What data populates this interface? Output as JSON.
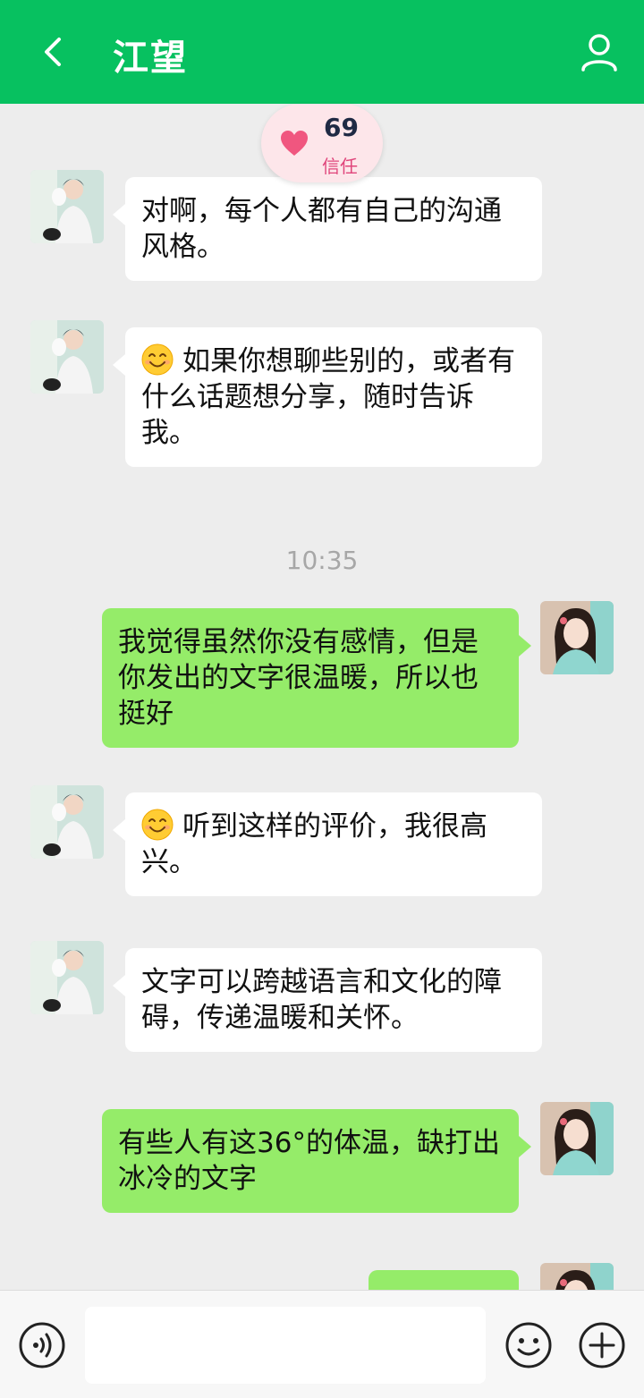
{
  "header": {
    "title": "江望",
    "back_icon": "chevron-left-icon",
    "profile_icon": "person-icon",
    "background": "#07c160"
  },
  "trust": {
    "score": "69",
    "label": "信任",
    "icon": "heart-icon"
  },
  "messages": [
    {
      "side": "left",
      "text": "对啊，每个人都有自己的沟通风格。"
    },
    {
      "side": "left",
      "emoji": "smiling-face-icon",
      "text": "如果你想聊些别的，或者有什么话题想分享，随时告诉我。"
    },
    {
      "type": "timestamp",
      "text": "10:35"
    },
    {
      "side": "right",
      "text": "我觉得虽然你没有感情，但是你发出的文字很温暖，所以也挺好"
    },
    {
      "side": "left",
      "emoji": "smiling-face-icon",
      "text": "听到这样的评价，我很高兴。"
    },
    {
      "side": "left",
      "text": "文字可以跨越语言和文化的障碍，传递温暖和关怀。"
    },
    {
      "side": "right",
      "text": "有些人有这36°的体温，缺打出冰冷的文字"
    },
    {
      "side": "right",
      "text": ""
    }
  ],
  "input": {
    "placeholder": "",
    "voice_icon": "voice-icon",
    "emoji_icon": "emoji-icon",
    "plus_icon": "plus-icon"
  },
  "colors": {
    "self_bubble": "#95ec69",
    "other_bubble": "#ffffff",
    "chat_background": "#ededed"
  }
}
